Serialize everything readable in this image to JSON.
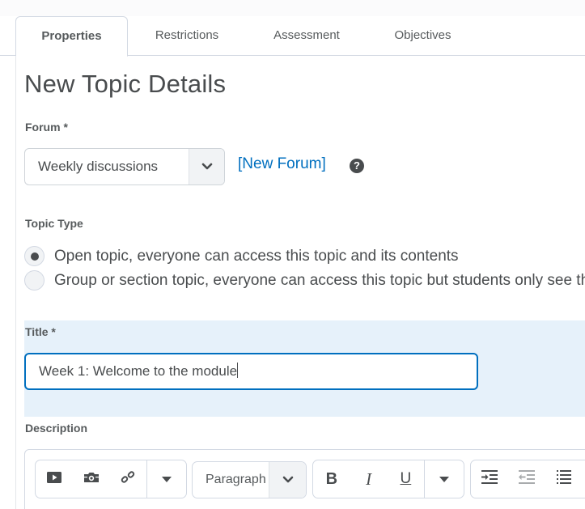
{
  "tabs": [
    {
      "label": "Properties",
      "active": true
    },
    {
      "label": "Restrictions",
      "active": false
    },
    {
      "label": "Assessment",
      "active": false
    },
    {
      "label": "Objectives",
      "active": false
    }
  ],
  "page_title": "New Topic Details",
  "forum": {
    "label": "Forum *",
    "selected": "Weekly discussions",
    "new_forum_link": "[New Forum]",
    "help_icon": "?"
  },
  "topic_type": {
    "label": "Topic Type",
    "options": [
      {
        "label": "Open topic, everyone can access this topic and its contents",
        "checked": true
      },
      {
        "label": "Group or section topic, everyone can access this topic but students only see threads from their group or section",
        "checked": false
      }
    ]
  },
  "title_field": {
    "label": "Title *",
    "value": "Week 1: Welcome to the module"
  },
  "description": {
    "label": "Description",
    "toolbar": {
      "insert_group": [
        "video-icon",
        "camera-icon",
        "link-icon",
        "more-dropdown-icon"
      ],
      "format_select": "Paragraph",
      "text_style_group": [
        "bold-icon",
        "italic-icon",
        "underline-icon",
        "more-dropdown-icon"
      ],
      "list_group": [
        "indent-icon",
        "outdent-icon",
        "bullet-list-icon"
      ]
    }
  },
  "colors": {
    "accent": "#006fbf",
    "title_band": "#e6f1fa",
    "text": "#494c4e",
    "border": "#d3d9e3"
  }
}
